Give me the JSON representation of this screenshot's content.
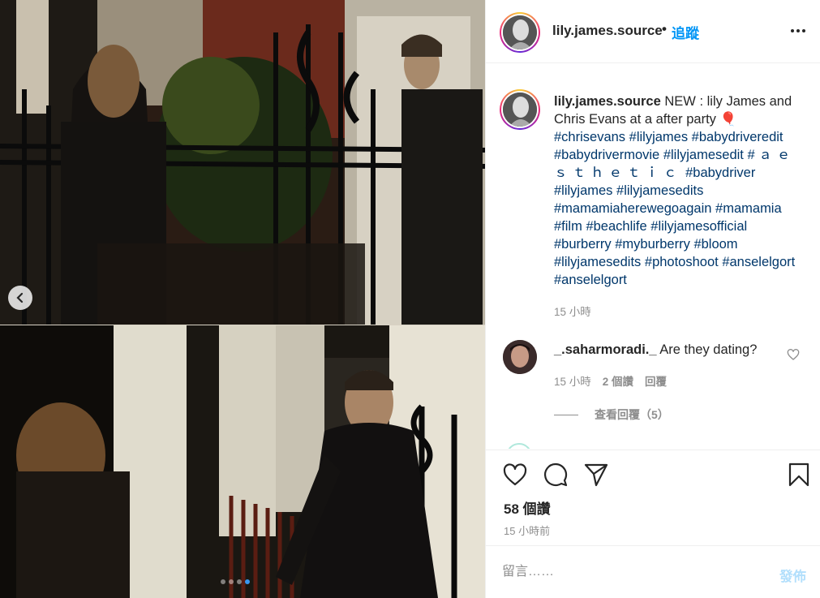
{
  "header": {
    "username": "lily.james.source",
    "separator": "•",
    "follow_label": "追蹤",
    "more_icon": "more-horizontal-icon"
  },
  "caption": {
    "username": "lily.james.source",
    "text": "NEW : lily James and Chris Evans at a after party",
    "emoji": "🎈",
    "hashtags_line1": [
      "#chrisevans",
      "#lilyjames",
      "#babydriveredit",
      "#babydrivermovie",
      "#lilyjamesedit",
      "#"
    ],
    "spaced_tag": "ａｅｓｔｈｅｔｉｃ",
    "hashtags_line2": [
      "#babydriver",
      "#lilyjames",
      "#lilyjamesedits",
      "#mamamiaherewegoagain",
      "#mamamia",
      "#film",
      "#beachlife",
      "#lilyjamesofficial",
      "#burberry",
      "#myburberry",
      "#bloom",
      "#lilyjamesedits",
      "#photoshoot",
      "#anselelgort",
      "#anselelgort"
    ],
    "time": "15 小時"
  },
  "comment": {
    "username": "_.saharmoradi._",
    "text": "Are they dating?",
    "time": "15 小時",
    "likes": "2 個讚",
    "reply": "回覆",
    "view_replies": "查看回覆（5）"
  },
  "actions": {
    "like_icon": "heart-icon",
    "comment_icon": "comment-icon",
    "share_icon": "send-icon",
    "save_icon": "bookmark-icon",
    "likes": "58 個讚",
    "posted": "15 小時前"
  },
  "comment_box": {
    "placeholder": "留言……",
    "post_label": "發佈"
  },
  "carousel": {
    "slides": 4,
    "active": 4,
    "prev_icon": "chevron-left-icon"
  },
  "colors": {
    "link": "#0095f6",
    "hashtag": "#00376b",
    "muted": "#8e8e8e",
    "post_disabled": "#b2dffc"
  }
}
